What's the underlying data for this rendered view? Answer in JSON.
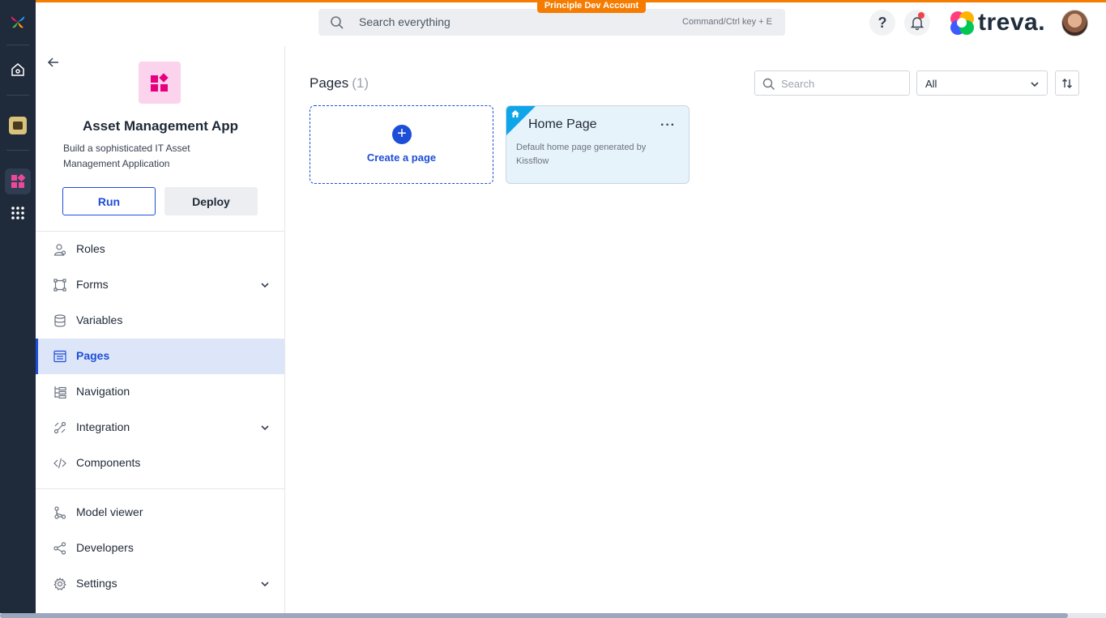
{
  "banner": "Principle Dev Account",
  "global_search": {
    "placeholder": "Search everything",
    "hint": "Command/Ctrl key + E"
  },
  "brand": {
    "wordmark": "treva."
  },
  "rail": {
    "icons": [
      "kissflow-logo-icon",
      "home-icon",
      "workspace-avatar-icon",
      "apps-icon",
      "grid-menu-icon"
    ]
  },
  "app": {
    "title": "Asset Management App",
    "description": "Build a sophisticated IT Asset Management Application",
    "run_label": "Run",
    "deploy_label": "Deploy"
  },
  "nav": {
    "items": [
      {
        "label": "Roles",
        "icon": "roles-icon"
      },
      {
        "label": "Forms",
        "icon": "forms-icon",
        "expandable": true
      },
      {
        "label": "Variables",
        "icon": "database-icon"
      },
      {
        "label": "Pages",
        "icon": "pages-icon",
        "active": true
      },
      {
        "label": "Navigation",
        "icon": "navigation-icon"
      },
      {
        "label": "Integration",
        "icon": "integration-icon",
        "expandable": true
      },
      {
        "label": "Components",
        "icon": "code-icon"
      }
    ],
    "bottom_items": [
      {
        "label": "Model viewer",
        "icon": "model-viewer-icon"
      },
      {
        "label": "Developers",
        "icon": "share-icon"
      },
      {
        "label": "Settings",
        "icon": "gear-icon",
        "expandable": true
      }
    ]
  },
  "pages": {
    "title": "Pages",
    "count": "(1)",
    "search_placeholder": "Search",
    "filter_value": "All",
    "create_label": "Create a page",
    "cards": [
      {
        "title": "Home Page",
        "description": "Default home page generated by Kissflow",
        "more": "···"
      }
    ]
  },
  "colors": {
    "accent": "#1d4ed8",
    "rail": "#1f2a3a",
    "banner": "#f57c00",
    "active_nav": "#dde6f8"
  }
}
